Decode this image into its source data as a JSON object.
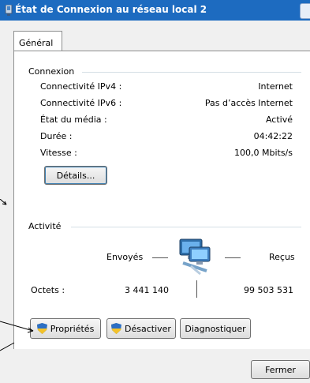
{
  "window": {
    "title": "État de Connexion au réseau local 2"
  },
  "tabs": [
    {
      "label": "Général"
    }
  ],
  "connexion": {
    "group_label": "Connexion",
    "rows": [
      {
        "label": "Connectivité IPv4 :",
        "value": "Internet"
      },
      {
        "label": "Connectivité IPv6 :",
        "value": "Pas d’accès Internet"
      },
      {
        "label": "État du média :",
        "value": "Activé"
      },
      {
        "label": "Durée :",
        "value": "04:42:22"
      },
      {
        "label": "Vitesse :",
        "value": "100,0 Mbits/s"
      }
    ],
    "details_button": "Détails..."
  },
  "activite": {
    "group_label": "Activité",
    "sent_label": "Envoyés",
    "received_label": "Reçus",
    "bytes_label": "Octets :",
    "bytes_sent": "3 441 140",
    "bytes_received": "99 503 531"
  },
  "buttons": {
    "properties": "Propriétés",
    "disable": "Désactiver",
    "diagnose": "Diagnostiquer",
    "close": "Fermer"
  },
  "icons": {
    "title": "network-adapter-icon",
    "activity": "network-computers-icon",
    "shield": "uac-shield-icon"
  },
  "colors": {
    "titlebar": "#1d6bc0",
    "background": "#f0f0f0",
    "panel": "#ffffff",
    "group_line": "#d5dfe5"
  }
}
